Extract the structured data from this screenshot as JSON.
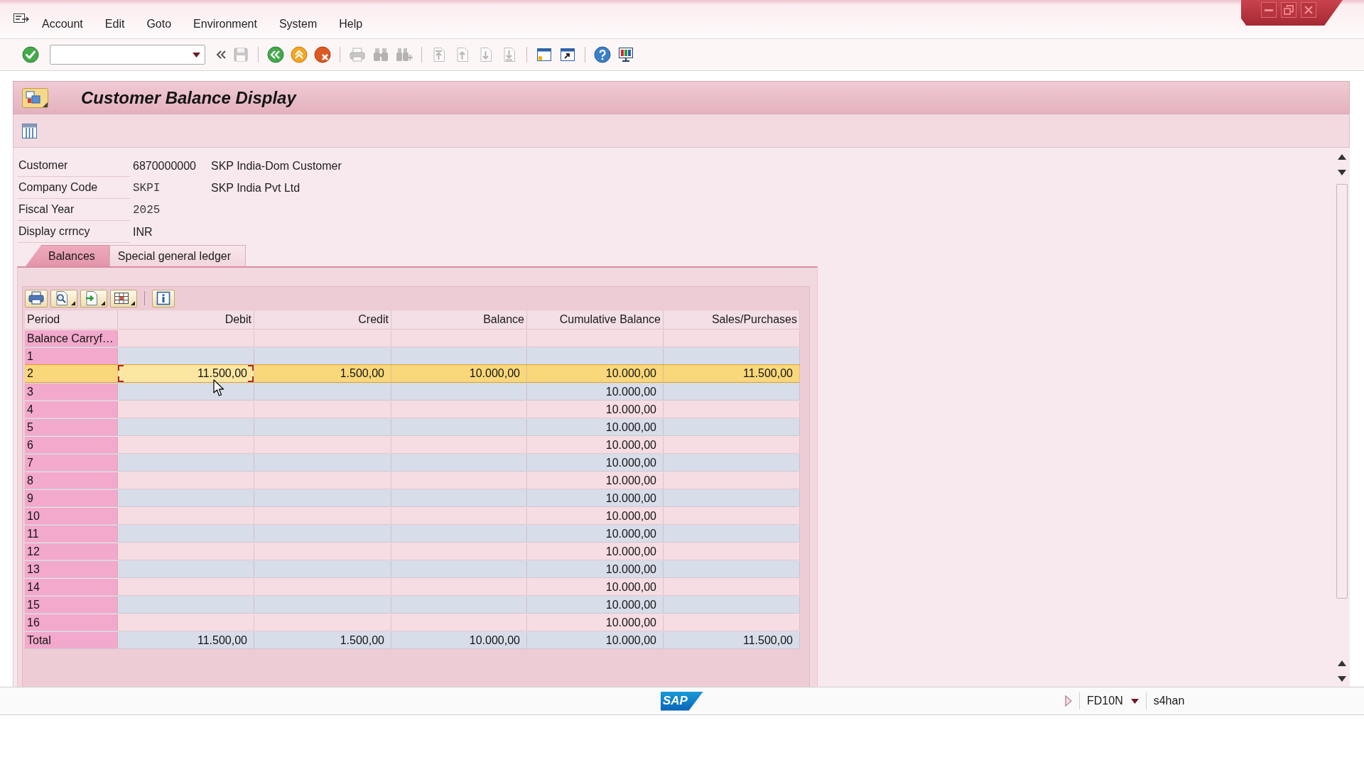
{
  "menu_bar": {
    "items": [
      "Account",
      "Edit",
      "Goto",
      "Environment",
      "System",
      "Help"
    ]
  },
  "toolbar": {
    "groups": [
      {
        "buttons": [
          {
            "kind": "enter",
            "disabled": false
          },
          {
            "kind": "command_field",
            "disabled": false
          },
          {
            "kind": "collapse",
            "disabled": false
          },
          {
            "kind": "save",
            "disabled": true
          }
        ]
      },
      {
        "buttons": [
          {
            "kind": "back",
            "disabled": false
          },
          {
            "kind": "exit",
            "disabled": false
          },
          {
            "kind": "cancel",
            "disabled": false
          }
        ]
      },
      {
        "buttons": [
          {
            "kind": "print",
            "disabled": true
          },
          {
            "kind": "find",
            "disabled": true
          },
          {
            "kind": "find_next",
            "disabled": true
          }
        ]
      },
      {
        "buttons": [
          {
            "kind": "first_page",
            "disabled": true
          },
          {
            "kind": "previous_page",
            "disabled": true
          },
          {
            "kind": "next_page",
            "disabled": true
          },
          {
            "kind": "last_page",
            "disabled": true
          }
        ]
      },
      {
        "buttons": [
          {
            "kind": "new_session",
            "disabled": false
          },
          {
            "kind": "shortcut",
            "disabled": false
          }
        ]
      },
      {
        "buttons": [
          {
            "kind": "help",
            "disabled": false
          },
          {
            "kind": "customize",
            "disabled": false
          }
        ]
      }
    ]
  },
  "title_bar": {
    "title": "Customer Balance Display"
  },
  "header_fields": [
    {
      "label": "Customer",
      "value": "6870000000",
      "kind": "plain",
      "description": "SKP India-Dom Customer"
    },
    {
      "label": "Company Code",
      "value": "SKPI",
      "kind": "mono",
      "description": "SKP India Pvt Ltd"
    },
    {
      "label": "Fiscal Year",
      "value": "2025",
      "kind": "mono"
    },
    {
      "label": "Display crrncy",
      "value": "INR",
      "kind": "plain"
    }
  ],
  "tabs": [
    {
      "label": "Balances",
      "selected": true
    },
    {
      "label": "Special general ledger",
      "selected": false
    }
  ],
  "alv_toolbar": {
    "groups": [
      {
        "buttons": [
          {
            "kind": "print",
            "menu": false
          },
          {
            "kind": "details",
            "menu": true
          },
          {
            "kind": "export",
            "menu": true
          },
          {
            "kind": "layout",
            "menu": true
          }
        ]
      },
      {
        "buttons": [
          {
            "kind": "info",
            "menu": false
          }
        ]
      }
    ]
  },
  "table": {
    "columns": [
      "Period",
      "Debit",
      "Credit",
      "Balance",
      "Cumulative Balance",
      "Sales/Purchases"
    ],
    "rows": [
      {
        "selected": false,
        "cells": [
          {
            "text": "Balance Carryf…",
            "focused": false
          },
          {
            "focused": false
          },
          {
            "focused": false
          },
          {
            "focused": false
          },
          {
            "focused": false
          },
          {
            "focused": false
          }
        ]
      },
      {
        "selected": false,
        "cells": [
          {
            "text": "1",
            "focused": false
          },
          {
            "focused": false
          },
          {
            "focused": false
          },
          {
            "focused": false
          },
          {
            "focused": false
          },
          {
            "focused": false
          }
        ]
      },
      {
        "selected": true,
        "cells": [
          {
            "text": "2",
            "focused": false
          },
          {
            "text": "11.500,00",
            "focused": true
          },
          {
            "text": "1.500,00",
            "focused": false
          },
          {
            "text": "10.000,00",
            "focused": false
          },
          {
            "text": "10.000,00",
            "focused": false
          },
          {
            "text": "11.500,00",
            "focused": false
          }
        ]
      },
      {
        "selected": false,
        "cells": [
          {
            "text": "3",
            "focused": false
          },
          {
            "focused": false
          },
          {
            "focused": false
          },
          {
            "focused": false
          },
          {
            "text": "10.000,00",
            "focused": false
          },
          {
            "focused": false
          }
        ]
      },
      {
        "selected": false,
        "cells": [
          {
            "text": "4",
            "focused": false
          },
          {
            "focused": false
          },
          {
            "focused": false
          },
          {
            "focused": false
          },
          {
            "text": "10.000,00",
            "focused": false
          },
          {
            "focused": false
          }
        ]
      },
      {
        "selected": false,
        "cells": [
          {
            "text": "5",
            "focused": false
          },
          {
            "focused": false
          },
          {
            "focused": false
          },
          {
            "focused": false
          },
          {
            "text": "10.000,00",
            "focused": false
          },
          {
            "focused": false
          }
        ]
      },
      {
        "selected": false,
        "cells": [
          {
            "text": "6",
            "focused": false
          },
          {
            "focused": false
          },
          {
            "focused": false
          },
          {
            "focused": false
          },
          {
            "text": "10.000,00",
            "focused": false
          },
          {
            "focused": false
          }
        ]
      },
      {
        "selected": false,
        "cells": [
          {
            "text": "7",
            "focused": false
          },
          {
            "focused": false
          },
          {
            "focused": false
          },
          {
            "focused": false
          },
          {
            "text": "10.000,00",
            "focused": false
          },
          {
            "focused": false
          }
        ]
      },
      {
        "selected": false,
        "cells": [
          {
            "text": "8",
            "focused": false
          },
          {
            "focused": false
          },
          {
            "focused": false
          },
          {
            "focused": false
          },
          {
            "text": "10.000,00",
            "focused": false
          },
          {
            "focused": false
          }
        ]
      },
      {
        "selected": false,
        "cells": [
          {
            "text": "9",
            "focused": false
          },
          {
            "focused": false
          },
          {
            "focused": false
          },
          {
            "focused": false
          },
          {
            "text": "10.000,00",
            "focused": false
          },
          {
            "focused": false
          }
        ]
      },
      {
        "selected": false,
        "cells": [
          {
            "text": "10",
            "focused": false
          },
          {
            "focused": false
          },
          {
            "focused": false
          },
          {
            "focused": false
          },
          {
            "text": "10.000,00",
            "focused": false
          },
          {
            "focused": false
          }
        ]
      },
      {
        "selected": false,
        "cells": [
          {
            "text": "11",
            "focused": false
          },
          {
            "focused": false
          },
          {
            "focused": false
          },
          {
            "focused": false
          },
          {
            "text": "10.000,00",
            "focused": false
          },
          {
            "focused": false
          }
        ]
      },
      {
        "selected": false,
        "cells": [
          {
            "text": "12",
            "focused": false
          },
          {
            "focused": false
          },
          {
            "focused": false
          },
          {
            "focused": false
          },
          {
            "text": "10.000,00",
            "focused": false
          },
          {
            "focused": false
          }
        ]
      },
      {
        "selected": false,
        "cells": [
          {
            "text": "13",
            "focused": false
          },
          {
            "focused": false
          },
          {
            "focused": false
          },
          {
            "focused": false
          },
          {
            "text": "10.000,00",
            "focused": false
          },
          {
            "focused": false
          }
        ]
      },
      {
        "selected": false,
        "cells": [
          {
            "text": "14",
            "focused": false
          },
          {
            "focused": false
          },
          {
            "focused": false
          },
          {
            "focused": false
          },
          {
            "text": "10.000,00",
            "focused": false
          },
          {
            "focused": false
          }
        ]
      },
      {
        "selected": false,
        "cells": [
          {
            "text": "15",
            "focused": false
          },
          {
            "focused": false
          },
          {
            "focused": false
          },
          {
            "focused": false
          },
          {
            "text": "10.000,00",
            "focused": false
          },
          {
            "focused": false
          }
        ]
      },
      {
        "selected": false,
        "cells": [
          {
            "text": "16",
            "focused": false
          },
          {
            "focused": false
          },
          {
            "focused": false
          },
          {
            "focused": false
          },
          {
            "text": "10.000,00",
            "focused": false
          },
          {
            "focused": false
          }
        ]
      }
    ],
    "totals": {
      "cells": [
        {
          "text": "Total",
          "focused": false
        },
        {
          "text": "11.500,00",
          "focused": false
        },
        {
          "text": "1.500,00",
          "focused": false
        },
        {
          "text": "10.000,00",
          "focused": false
        },
        {
          "text": "10.000,00",
          "focused": false
        },
        {
          "text": "11.500,00",
          "focused": false
        }
      ]
    }
  },
  "status_bar": {
    "logo": "SAP",
    "transaction": "FD10N",
    "system": "s4han"
  }
}
